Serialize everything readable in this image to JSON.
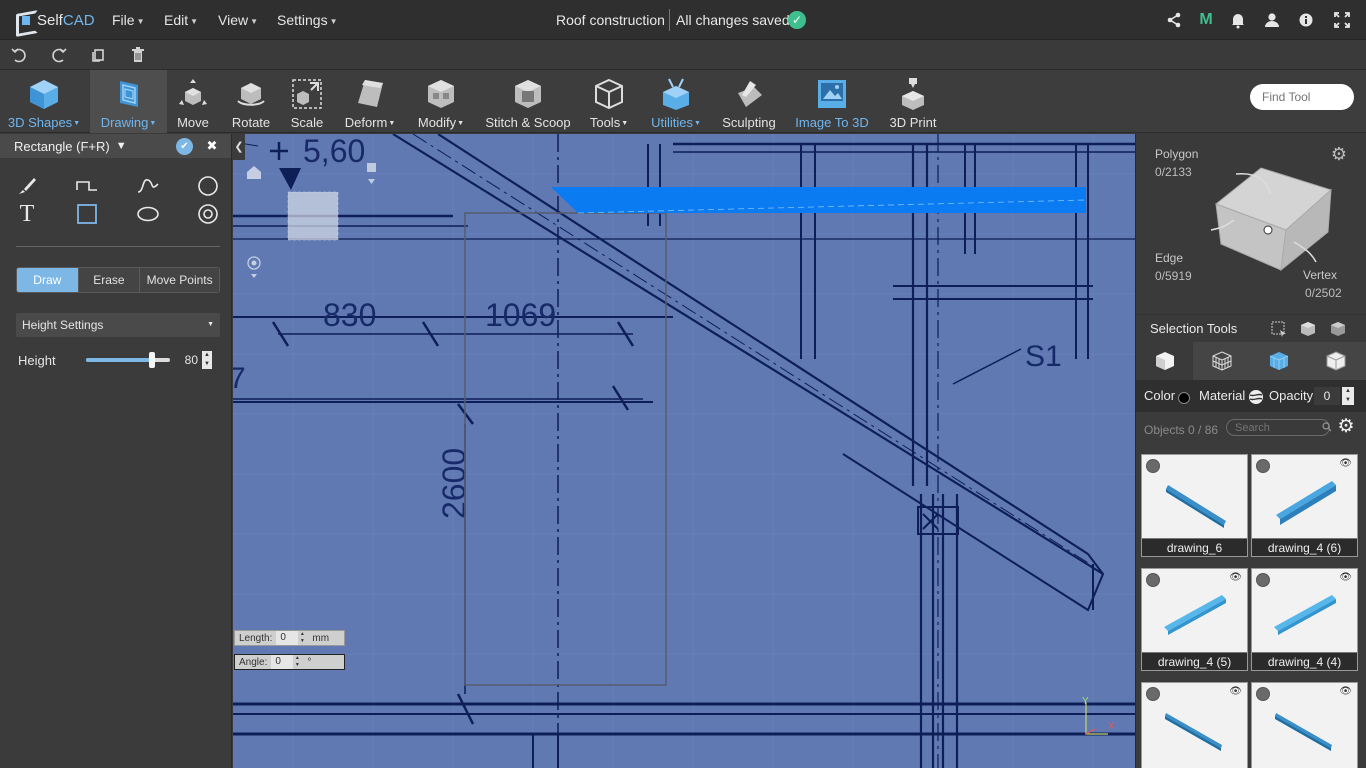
{
  "app": {
    "logo_self": "Self",
    "logo_cad": "CAD",
    "menus": [
      "File",
      "Edit",
      "View",
      "Settings"
    ],
    "project_title": "Roof construction",
    "save_status": "All changes saved"
  },
  "ribbon": {
    "tools": [
      {
        "label": "3D Shapes",
        "dropdown": true,
        "color": "blue"
      },
      {
        "label": "Drawing",
        "dropdown": true,
        "color": "blue",
        "active": true
      },
      {
        "label": "Move"
      },
      {
        "label": "Rotate"
      },
      {
        "label": "Scale"
      },
      {
        "label": "Deform",
        "dropdown": true
      },
      {
        "label": "Modify",
        "dropdown": true
      },
      {
        "label": "Stitch & Scoop"
      },
      {
        "label": "Tools",
        "dropdown": true
      },
      {
        "label": "Utilities",
        "dropdown": true,
        "color": "blue"
      },
      {
        "label": "Sculpting"
      },
      {
        "label": "Image To 3D",
        "color": "blue"
      },
      {
        "label": "3D Print"
      }
    ],
    "find_tool_placeholder": "Find Tool"
  },
  "left_panel": {
    "title": "Rectangle (F+R)",
    "modes": [
      "Draw",
      "Erase",
      "Move Points"
    ],
    "active_mode": "Draw",
    "settings_dropdown": "Height Settings",
    "height_label": "Height",
    "height_value": "80",
    "height_slider_fraction": 0.79
  },
  "viewport": {
    "length_label": "Length:",
    "length_value": "0",
    "length_unit": "mm",
    "angle_label": "Angle:",
    "angle_value": "0",
    "angle_unit": "°",
    "blueprint_labels": [
      "5,60",
      "830",
      "1069",
      "2600",
      "S1",
      "7"
    ],
    "axis_y": "Y",
    "axis_x": "X"
  },
  "right_panel": {
    "polygon_label": "Polygon",
    "polygon_count": "0/2133",
    "edge_label": "Edge",
    "edge_count": "0/5919",
    "vertex_label": "Vertex",
    "vertex_count": "0/2502",
    "selection_tools_label": "Selection Tools",
    "color_label": "Color",
    "material_label": "Material",
    "opacity_label": "Opacity",
    "opacity_value": "0",
    "objects_count": "Objects 0 / 86",
    "search_placeholder": "Search",
    "objects": [
      {
        "name": "drawing_6",
        "hidden_icon": false
      },
      {
        "name": "drawing_4 (6)",
        "hidden_icon": true
      },
      {
        "name": "drawing_4 (5)",
        "hidden_icon": true
      },
      {
        "name": "drawing_4 (4)",
        "hidden_icon": true
      },
      {
        "name": "",
        "hidden_icon": true
      },
      {
        "name": "",
        "hidden_icon": true
      }
    ]
  },
  "colors": {
    "accent": "#7db7e6",
    "viewport_bg": "#6079b3",
    "highlight": "#0a7bf0",
    "saved_check": "#3fbf8f"
  }
}
